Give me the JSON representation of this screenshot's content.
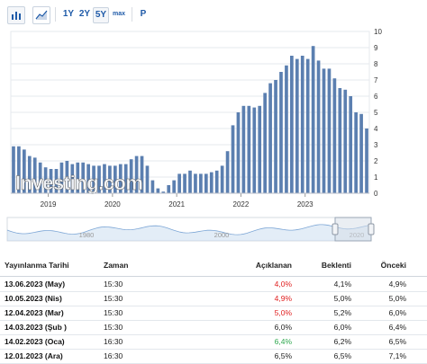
{
  "toolbar": {
    "buttons": [
      "1Y",
      "2Y",
      "5Y",
      "max",
      "P"
    ]
  },
  "colors": {
    "bar": "#5b7fb0",
    "accent": "#1e5aa8",
    "red": "#e02020",
    "green": "#2fa84f",
    "navigator": "#aecbe8"
  },
  "watermark": "Investing.com",
  "chart_data": {
    "type": "bar",
    "x_tick_labels": [
      "2019",
      "2020",
      "2021",
      "2022",
      "2023"
    ],
    "y_tick_labels": [
      "0",
      "1",
      "2",
      "3",
      "4",
      "5",
      "6",
      "7",
      "8",
      "9",
      "10"
    ],
    "ylim": [
      0,
      10
    ],
    "y_axis_side": "right",
    "grid": true,
    "start_month": "2018-06",
    "values": [
      2.9,
      2.9,
      2.7,
      2.3,
      2.2,
      1.9,
      1.6,
      1.5,
      1.5,
      1.9,
      2.0,
      1.8,
      1.9,
      1.9,
      1.8,
      1.7,
      1.7,
      1.8,
      1.7,
      1.7,
      1.8,
      1.8,
      2.1,
      2.3,
      2.3,
      1.7,
      0.8,
      0.3,
      0.1,
      0.5,
      0.8,
      1.2,
      1.2,
      1.4,
      1.2,
      1.2,
      1.2,
      1.3,
      1.4,
      1.7,
      2.6,
      4.2,
      5.0,
      5.4,
      5.4,
      5.3,
      5.4,
      6.2,
      6.8,
      7.0,
      7.5,
      7.9,
      8.5,
      8.3,
      8.5,
      8.3,
      9.1,
      8.2,
      7.7,
      7.7,
      7.1,
      6.5,
      6.4,
      6.0,
      5.0,
      4.9,
      4.0
    ]
  },
  "navigator": {
    "tick_labels": [
      "1980",
      "2000",
      "2020"
    ]
  },
  "table": {
    "headers": {
      "date": "Yayınlanma Tarihi",
      "time": "Zaman",
      "actual": "Açıklanan",
      "forecast": "Beklenti",
      "previous": "Önceki"
    },
    "rows": [
      {
        "date": "13.06.2023 (May)",
        "time": "15:30",
        "actual": "4,0%",
        "actual_status": "negative",
        "forecast": "4,1%",
        "previous": "4,9%"
      },
      {
        "date": "10.05.2023 (Nis)",
        "time": "15:30",
        "actual": "4,9%",
        "actual_status": "negative",
        "forecast": "5,0%",
        "previous": "5,0%"
      },
      {
        "date": "12.04.2023 (Mar)",
        "time": "15:30",
        "actual": "5,0%",
        "actual_status": "negative",
        "forecast": "5,2%",
        "previous": "6,0%"
      },
      {
        "date": "14.03.2023 (Şub )",
        "time": "15:30",
        "actual": "6,0%",
        "actual_status": "neutral",
        "forecast": "6,0%",
        "previous": "6,4%"
      },
      {
        "date": "14.02.2023 (Oca)",
        "time": "16:30",
        "actual": "6,4%",
        "actual_status": "positive",
        "forecast": "6,2%",
        "previous": "6,5%"
      },
      {
        "date": "12.01.2023 (Ara)",
        "time": "16:30",
        "actual": "6,5%",
        "actual_status": "neutral",
        "forecast": "6,5%",
        "previous": "7,1%"
      }
    ]
  }
}
